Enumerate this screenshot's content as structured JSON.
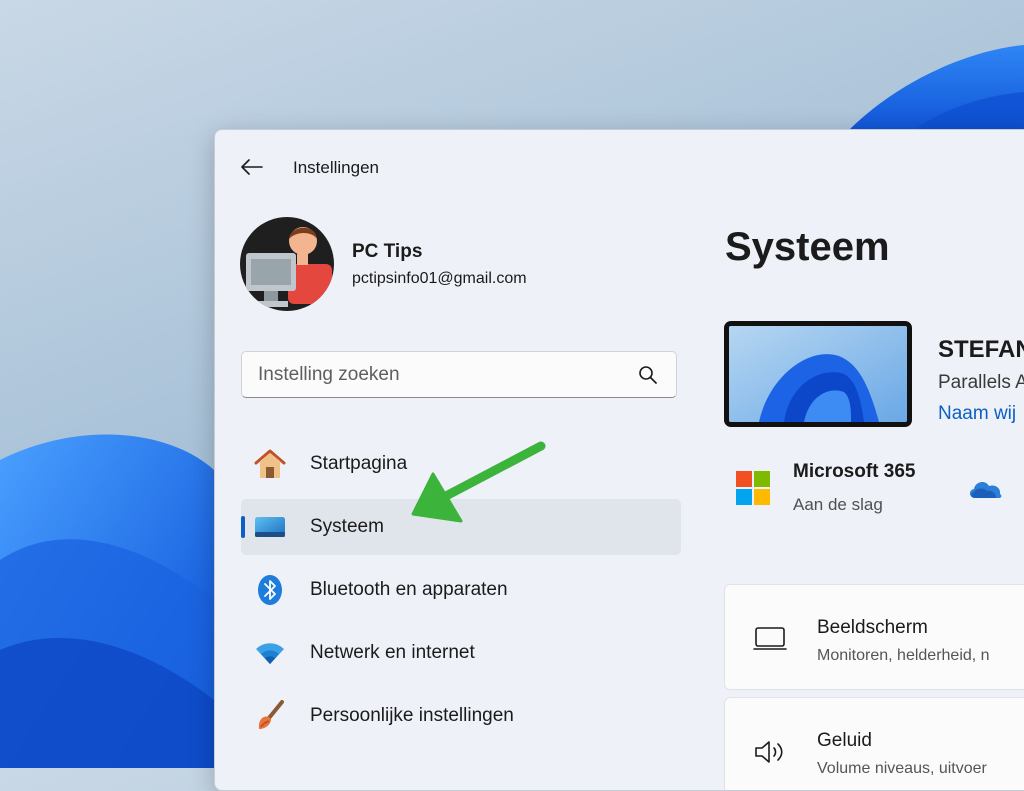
{
  "window": {
    "title": "Instellingen",
    "back_icon": "arrow-left-icon"
  },
  "profile": {
    "name": "PC Tips",
    "email": "pctipsinfo01@gmail.com",
    "avatar_icon": "user-at-computer-avatar-icon"
  },
  "search": {
    "placeholder": "Instelling zoeken",
    "icon": "search-icon"
  },
  "sidebar": {
    "items": [
      {
        "label": "Startpagina",
        "icon": "home-icon",
        "active": false
      },
      {
        "label": "Systeem",
        "icon": "monitor-icon",
        "active": true
      },
      {
        "label": "Bluetooth en apparaten",
        "icon": "bluetooth-icon",
        "active": false
      },
      {
        "label": "Netwerk en internet",
        "icon": "wifi-icon",
        "active": false
      },
      {
        "label": "Persoonlijke instellingen",
        "icon": "paintbrush-icon",
        "active": false
      }
    ]
  },
  "main": {
    "title": "Systeem",
    "device": {
      "name": "STEFAN",
      "model": "Parallels A",
      "rename_link": "Naam wij"
    },
    "microsoft365": {
      "title": "Microsoft 365",
      "subtitle": "Aan de slag"
    },
    "cards": [
      {
        "title": "Beeldscherm",
        "subtitle": "Monitoren, helderheid, n",
        "icon": "display-icon"
      },
      {
        "title": "Geluid",
        "subtitle": "Volume niveaus, uitvoer",
        "icon": "speaker-icon"
      }
    ]
  },
  "colors": {
    "accent": "#0b5fc5",
    "annotation_arrow": "#3cb33a",
    "window_bg": "#eef2f8",
    "active_item_bg": "#e0e5ec"
  }
}
